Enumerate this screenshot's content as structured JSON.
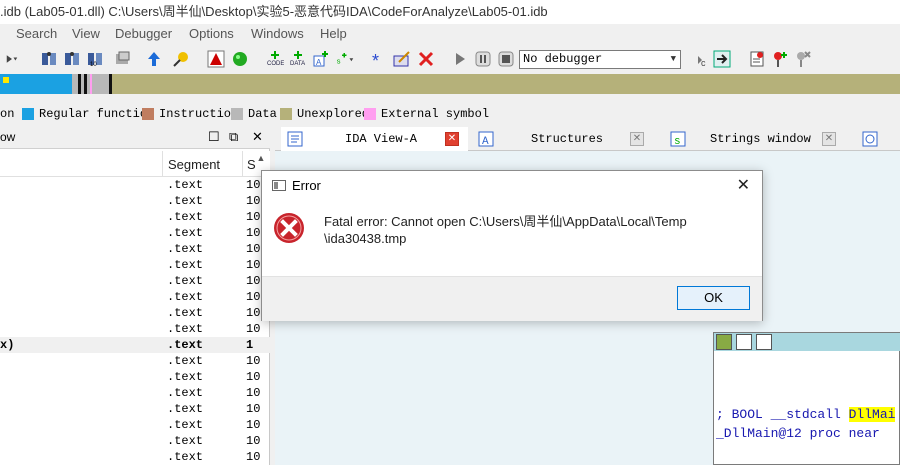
{
  "window": {
    "title": ".idb (Lab05-01.dll) C:\\Users\\周半仙\\Desktop\\实验5-恶意代码IDA\\CodeForAnalyze\\Lab05-01.idb"
  },
  "menu": [
    "Search",
    "View",
    "Debugger",
    "Options",
    "Windows",
    "Help"
  ],
  "toolbar": {
    "debugger_select": "No debugger"
  },
  "legend": [
    {
      "label": "on",
      "color": "#1f3fa0"
    },
    {
      "label": "Regular function",
      "color": "#1ba1e2"
    },
    {
      "label": "Instruction",
      "color": "#c07d60"
    },
    {
      "label": "Data",
      "color": "#b8b8b8"
    },
    {
      "label": "Unexplored",
      "color": "#b5b17a"
    },
    {
      "label": "External symbol",
      "color": "#ff9ef0"
    }
  ],
  "left_panel": {
    "title": "ow",
    "columns": [
      "Segment",
      "S"
    ],
    "rows": [
      {
        "name": "",
        "segment": ".text",
        "s": "10"
      },
      {
        "name": "",
        "segment": ".text",
        "s": "10"
      },
      {
        "name": "",
        "segment": ".text",
        "s": "10"
      },
      {
        "name": "",
        "segment": ".text",
        "s": "10"
      },
      {
        "name": "",
        "segment": ".text",
        "s": "10"
      },
      {
        "name": "",
        "segment": ".text",
        "s": "10"
      },
      {
        "name": "",
        "segment": ".text",
        "s": "10"
      },
      {
        "name": "",
        "segment": ".text",
        "s": "10"
      },
      {
        "name": "",
        "segment": ".text",
        "s": "10"
      },
      {
        "name": "",
        "segment": ".text",
        "s": "10"
      },
      {
        "name": "x)",
        "segment": ".text",
        "s": "1",
        "selected": true
      },
      {
        "name": "",
        "segment": ".text",
        "s": "10"
      },
      {
        "name": "",
        "segment": ".text",
        "s": "10"
      },
      {
        "name": "",
        "segment": ".text",
        "s": "10"
      },
      {
        "name": "",
        "segment": ".text",
        "s": "10"
      },
      {
        "name": "",
        "segment": ".text",
        "s": "10"
      },
      {
        "name": "",
        "segment": ".text",
        "s": "10"
      },
      {
        "name": "",
        "segment": ".text",
        "s": "10"
      }
    ]
  },
  "tabs": [
    {
      "label": "IDA View-A",
      "active": true
    },
    {
      "label": "Structures",
      "active": false
    },
    {
      "label": "Strings window",
      "active": false
    }
  ],
  "code_lines": [
    {
      "prefix": "; BOOL __stdcall ",
      "highlight": "DllMai",
      "suffix": ""
    },
    {
      "prefix": "_DllMain@12 proc near",
      "highlight": "",
      "suffix": ""
    }
  ],
  "dialog": {
    "title": "Error",
    "message_line1": "Fatal error: Cannot open C:\\Users\\周半仙\\AppData\\Local\\Temp",
    "message_line2": "\\ida30438.tmp",
    "ok_label": "OK"
  }
}
